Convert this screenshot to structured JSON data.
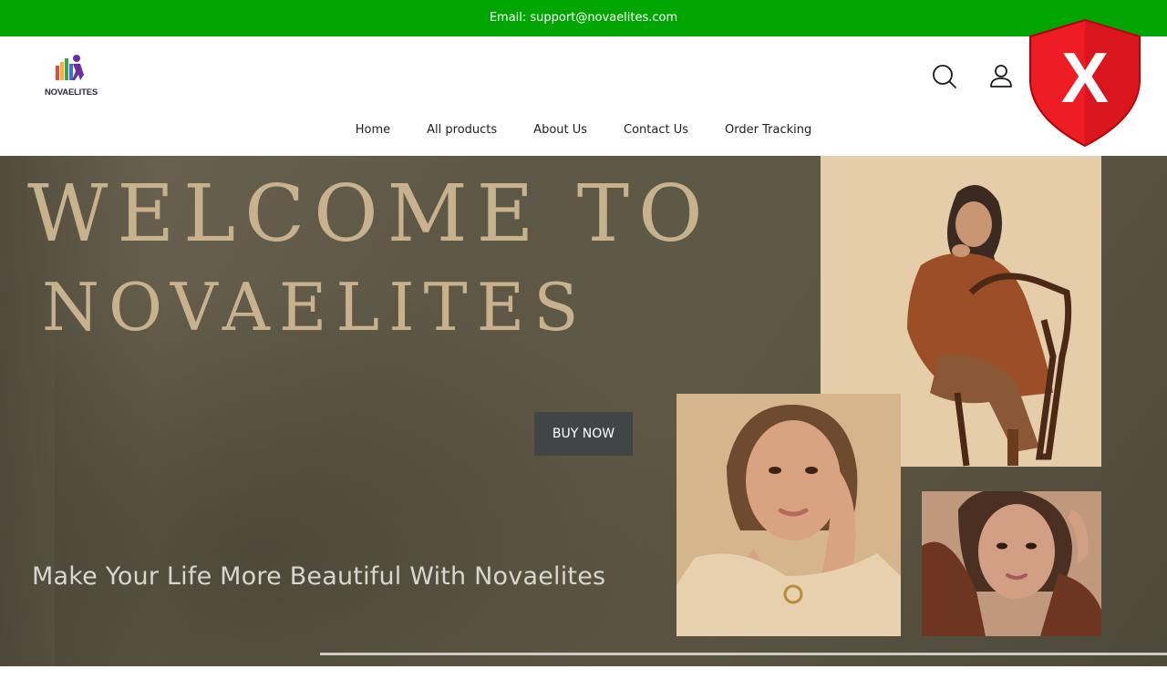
{
  "announcement": {
    "email_text": "Email: support@novaelites.com"
  },
  "header": {
    "logo_text": "NOVAELITES",
    "icons": {
      "search": "search-icon",
      "account": "user-icon"
    }
  },
  "nav": {
    "items": [
      "Home",
      "All products",
      "About Us",
      "Contact Us",
      "Order Tracking"
    ]
  },
  "hero": {
    "title_line1": "WELCOME TO",
    "title_line2": "NOVAELITES",
    "cta_label": "BUY NOW",
    "tagline": "Make Your Life More Beautiful With Novaelites"
  },
  "overlay_badge": {
    "icon": "shield-x-icon",
    "label": "X"
  },
  "colors": {
    "announcement_bg": "#02a602",
    "hero_bg": "#5f5846",
    "title_color": "#c8b18d",
    "cta_bg": "#424545",
    "badge_red": "#ee1c24"
  }
}
